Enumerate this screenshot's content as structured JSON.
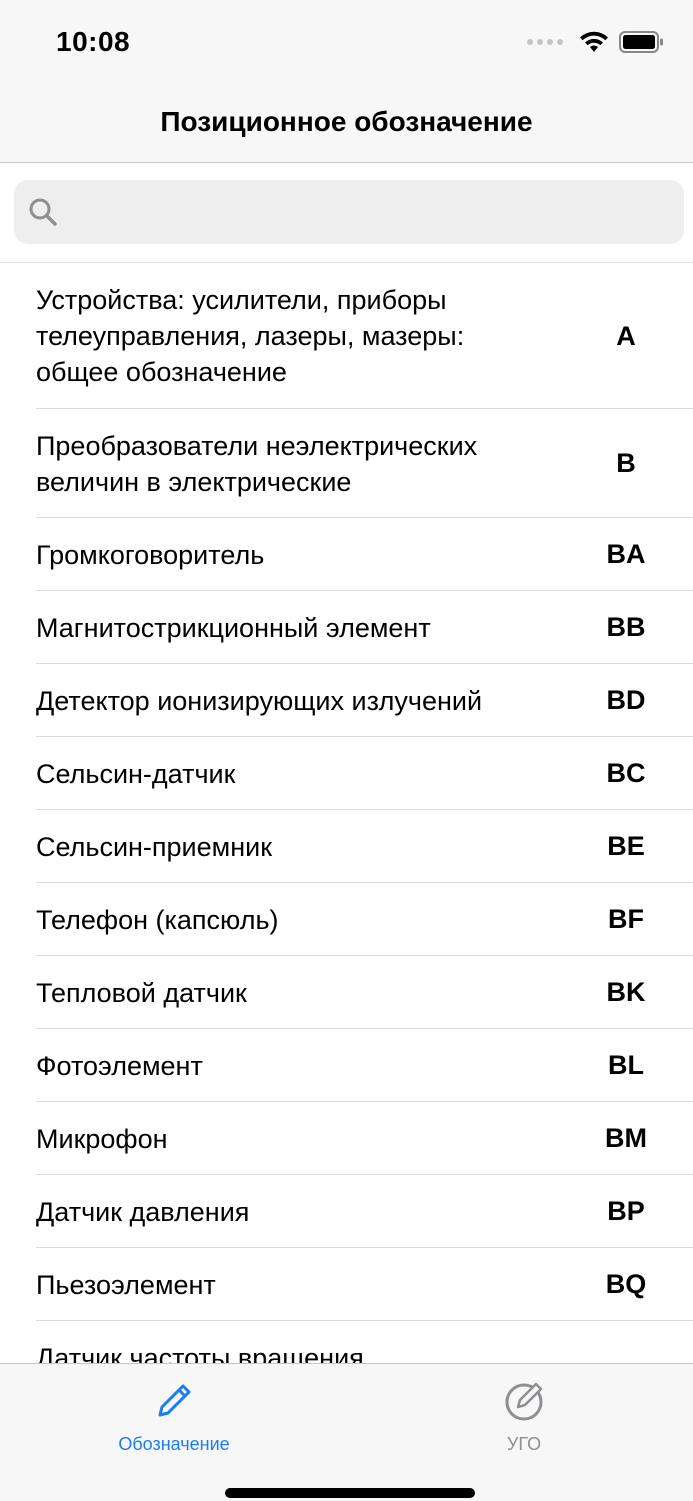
{
  "status_bar": {
    "time": "10:08",
    "icons": [
      "signal-dots-icon",
      "wifi-icon",
      "battery-icon"
    ]
  },
  "nav": {
    "title": "Позиционное обозначение"
  },
  "search": {
    "placeholder": "",
    "value": "",
    "icon": "search-icon"
  },
  "list": {
    "items": [
      {
        "title": "Устройства: усилители, приборы телеуправления, лазеры, мазеры: общее обозначение",
        "code": "A"
      },
      {
        "title": "Преобразователи неэлектрических величин в электрические",
        "code": "B"
      },
      {
        "title": "Громкоговоритель",
        "code": "BA"
      },
      {
        "title": "Магнитострикционный элемент",
        "code": "BB"
      },
      {
        "title": "Детектор ионизирующих излучений",
        "code": "BD"
      },
      {
        "title": "Сельсин-датчик",
        "code": "BC"
      },
      {
        "title": "Сельсин-приемник",
        "code": "BE"
      },
      {
        "title": "Телефон (капсюль)",
        "code": "BF"
      },
      {
        "title": "Тепловой датчик",
        "code": "BK"
      },
      {
        "title": "Фотоэлемент",
        "code": "BL"
      },
      {
        "title": "Микрофон",
        "code": "BM"
      },
      {
        "title": "Датчик давления",
        "code": "BP"
      },
      {
        "title": "Пьезоэлемент",
        "code": "BQ"
      },
      {
        "title": "Датчик частоты вращения",
        "code": ""
      }
    ]
  },
  "tabbar": {
    "tabs": [
      {
        "label": "Обозначение",
        "icon": "pencil-icon",
        "selected": true
      },
      {
        "label": "УГО",
        "icon": "pencil-circle-icon",
        "selected": false
      }
    ]
  },
  "colors": {
    "accent": "#1a7ef0",
    "inactive": "#8e8e93",
    "bar_background": "#f7f7f7",
    "search_background": "#eeeeef",
    "separator": "#dcdcdf"
  }
}
